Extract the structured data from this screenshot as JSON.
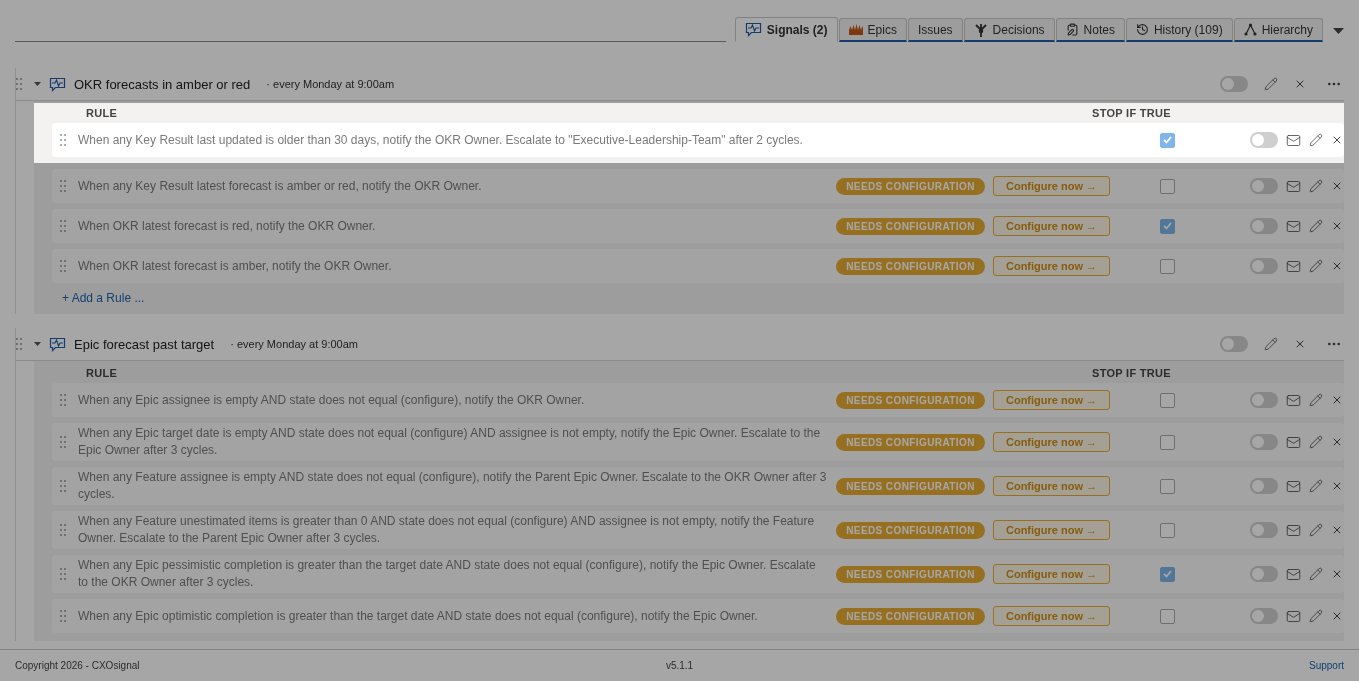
{
  "tabs": [
    {
      "label": "Signals (2)",
      "selected": true
    },
    {
      "label": "Epics",
      "selected": false
    },
    {
      "label": "Issues",
      "selected": false
    },
    {
      "label": "Decisions",
      "selected": false
    },
    {
      "label": "Notes",
      "selected": false
    },
    {
      "label": "History (109)",
      "selected": false
    },
    {
      "label": "Hierarchy",
      "selected": false
    }
  ],
  "signals": [
    {
      "title": "OKR forecasts in amber or red",
      "schedule": "· every Monday at 9:00am",
      "expanded": true,
      "enabled": false,
      "columns": {
        "rule": "RULE",
        "stop": "STOP IF TRUE"
      },
      "rules": [
        {
          "text": "When any Key Result last updated is older than 30 days, notify the OKR Owner. Escalate to \"Executive-Leadership-Team\" after 2 cycles.",
          "stop_if_true": true,
          "enabled": false,
          "highlighted": true
        },
        {
          "text": "When any Key Result latest forecast is amber or red, notify the OKR Owner.",
          "badge": "NEEDS CONFIGURATION",
          "action": "Configure now →",
          "stop_if_true": false,
          "enabled": false,
          "highlighted": false
        },
        {
          "text": "When OKR latest forecast is red, notify the OKR Owner.",
          "badge": "NEEDS CONFIGURATION",
          "action": "Configure now →",
          "stop_if_true": true,
          "enabled": false,
          "highlighted": false
        },
        {
          "text": "When OKR latest forecast is amber, notify the OKR Owner.",
          "badge": "NEEDS CONFIGURATION",
          "action": "Configure now →",
          "stop_if_true": false,
          "enabled": false,
          "highlighted": false
        }
      ],
      "add_rule": "+ Add a Rule ..."
    },
    {
      "title": "Epic forecast past target",
      "schedule": "· every Monday at 9:00am",
      "expanded": true,
      "enabled": false,
      "columns": {
        "rule": "RULE",
        "stop": "STOP IF TRUE"
      },
      "rules": [
        {
          "text": "When any Epic assignee is empty AND state does not equal (configure), notify the OKR Owner.",
          "badge": "NEEDS CONFIGURATION",
          "action": "Configure now →",
          "stop_if_true": false,
          "enabled": false,
          "highlighted": false
        },
        {
          "text": "When any Epic target date is empty AND state does not equal (configure) AND assignee is not empty, notify the Epic Owner. Escalate to the Epic Owner after 3 cycles.",
          "badge": "NEEDS CONFIGURATION",
          "action": "Configure now →",
          "stop_if_true": false,
          "enabled": false,
          "highlighted": false
        },
        {
          "text": "When any Feature assignee is empty AND state does not equal (configure), notify the Parent Epic Owner. Escalate to the OKR Owner after 3 cycles.",
          "badge": "NEEDS CONFIGURATION",
          "action": "Configure now →",
          "stop_if_true": false,
          "enabled": false,
          "highlighted": false
        },
        {
          "text": "When any Feature unestimated items is greater than 0 AND state does not equal (configure) AND assignee is not empty, notify the Feature Owner. Escalate to the Parent Epic Owner after 3 cycles.",
          "badge": "NEEDS CONFIGURATION",
          "action": "Configure now →",
          "stop_if_true": false,
          "enabled": false,
          "highlighted": false
        },
        {
          "text": "When any Epic pessimistic completion is greater than the target date AND state does not equal (configure), notify the Epic Owner. Escalate to the OKR Owner after 3 cycles.",
          "badge": "NEEDS CONFIGURATION",
          "action": "Configure now →",
          "stop_if_true": true,
          "enabled": false,
          "highlighted": false
        },
        {
          "text": "When any Epic optimistic completion is greater than the target date AND state does not equal (configure), notify the Epic Owner.",
          "badge": "NEEDS CONFIGURATION",
          "action": "Configure now →",
          "stop_if_true": false,
          "enabled": false,
          "highlighted": false
        }
      ]
    }
  ],
  "footer": {
    "copyright": "Copyright 2026 - CXOsignal",
    "version": "v5.1.1",
    "support": "Support"
  }
}
